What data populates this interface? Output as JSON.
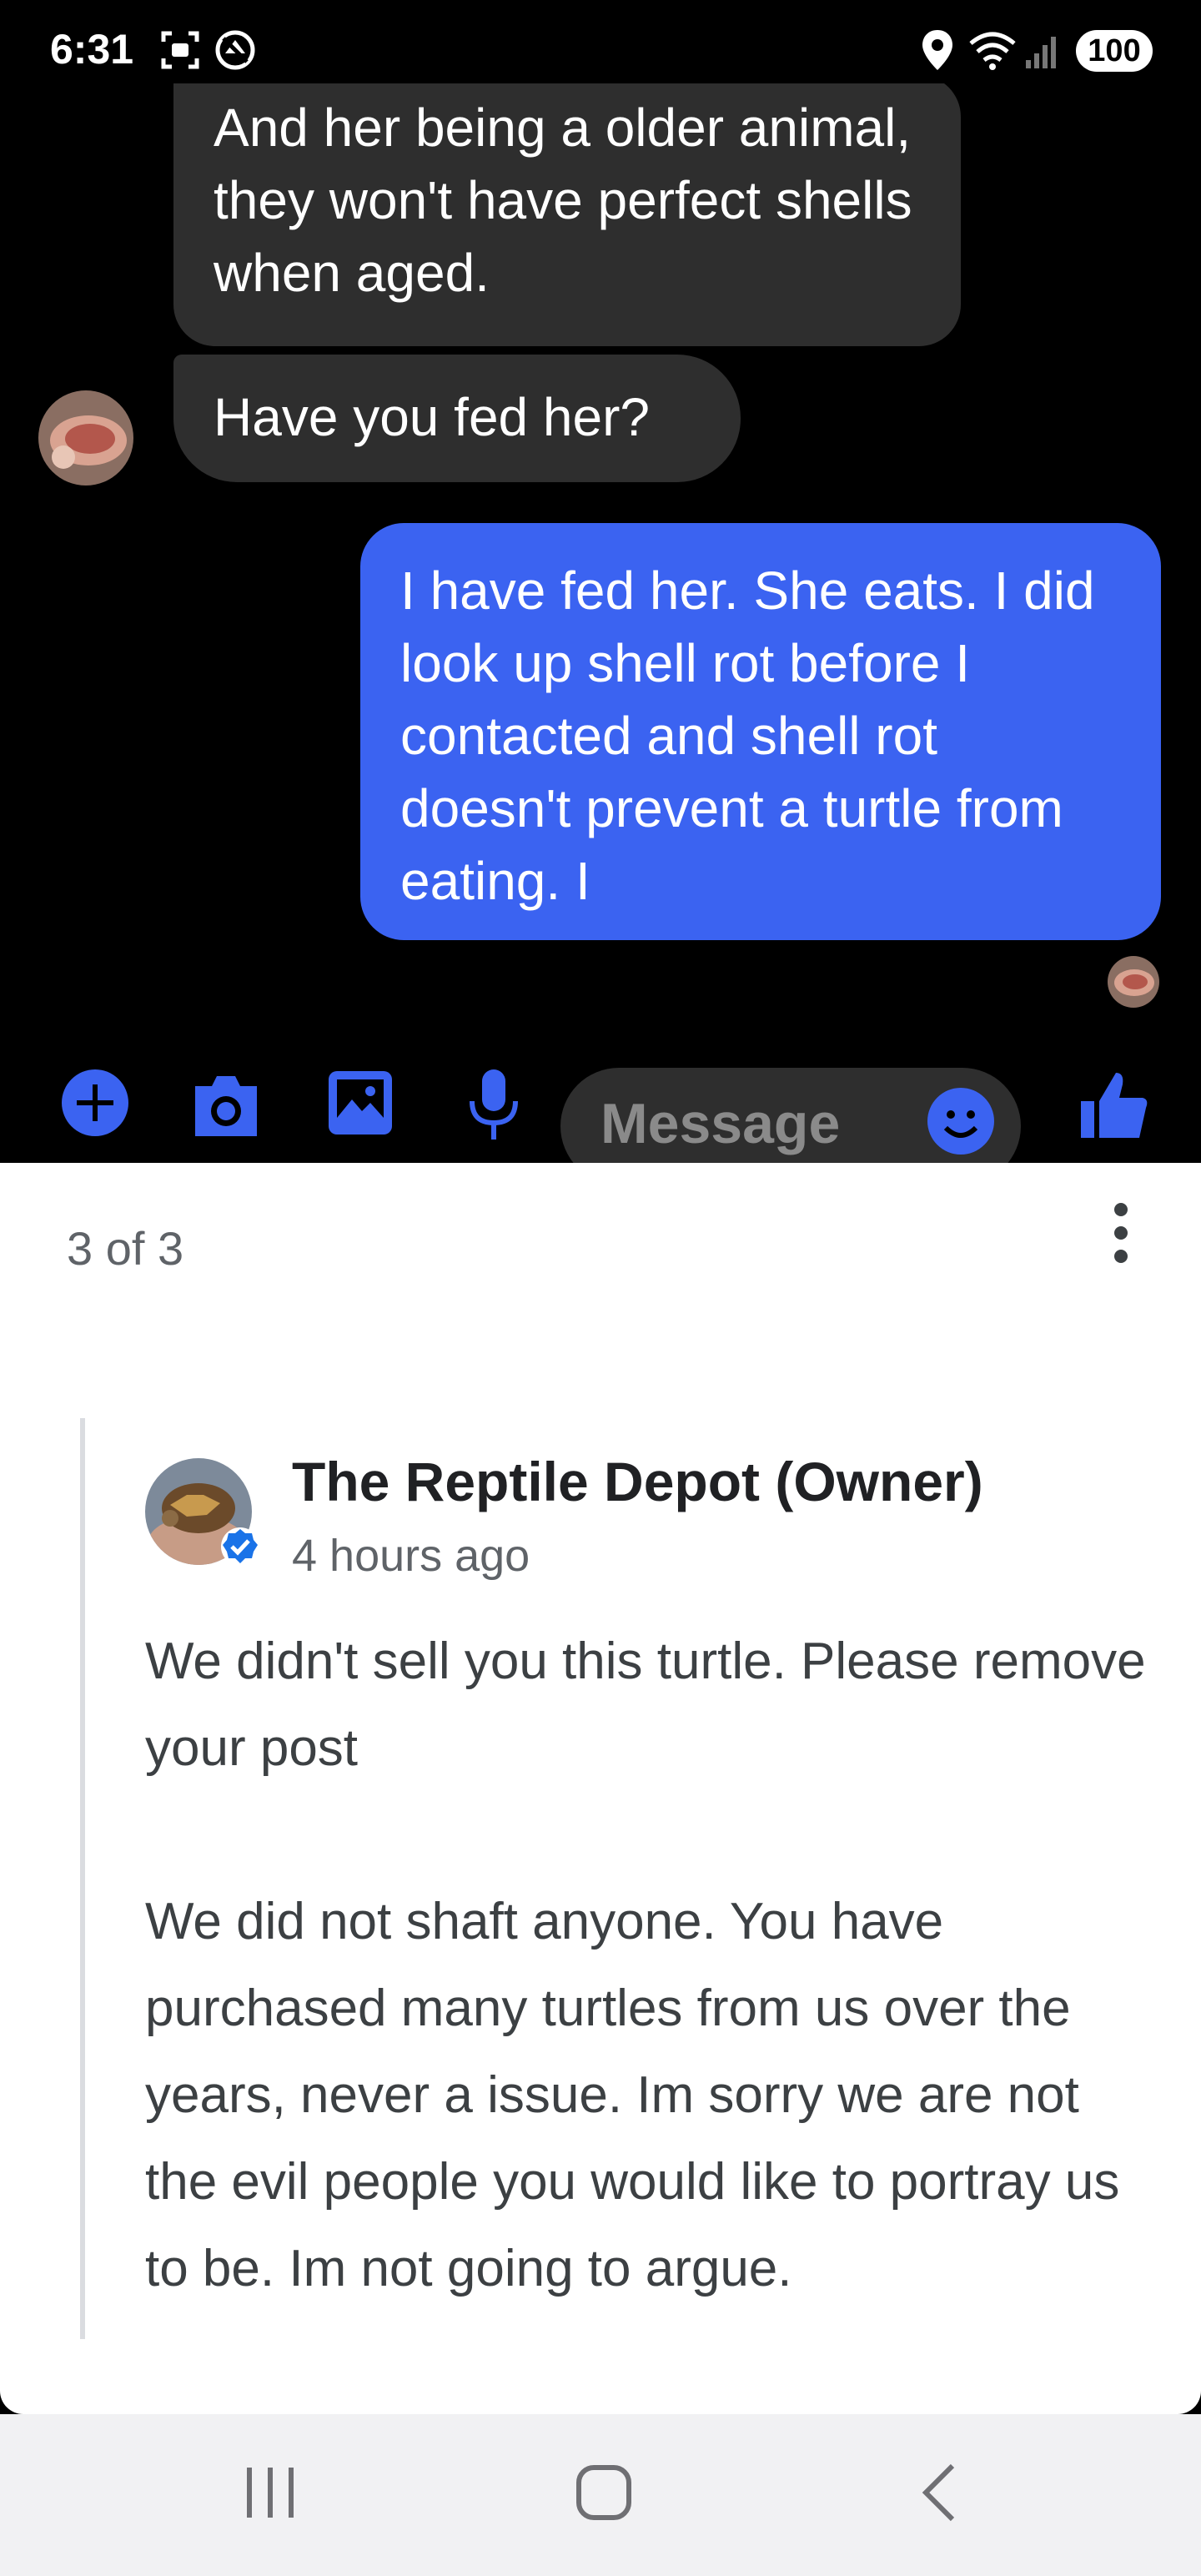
{
  "status_bar": {
    "time": "6:31",
    "battery": "100",
    "icons": [
      "screenshot-icon",
      "no-disturb-icon",
      "location-icon",
      "wifi-icon",
      "signal-icon"
    ]
  },
  "chat": {
    "incoming_messages": [
      "And her being a older animal,  they won't have perfect shells when aged.",
      "Have you fed her?"
    ],
    "outgoing_message": "I have fed her. She eats. I did look up shell rot before I contacted and shell rot doesn't prevent a turtle from eating. I",
    "composer": {
      "placeholder": "Message",
      "icons": [
        "add-icon",
        "camera-icon",
        "gallery-icon",
        "microphone-icon",
        "emoji-icon",
        "thumbs-up-icon"
      ]
    },
    "colors": {
      "incoming_bubble": "#2e2e2e",
      "outgoing_bubble": "#3b63f1",
      "accent": "#3b63f1"
    }
  },
  "sheet": {
    "page_counter": "3 of 3",
    "review": {
      "owner_name": "The Reptile Depot (Owner)",
      "time": "4 hours ago",
      "paragraphs": [
        "We didn't sell you this turtle.  Please remove your post",
        "We did not shaft anyone. You have purchased many turtles from us over the years, never a issue. Im sorry we are not the evil people you would like to portray us to be. Im not going to argue."
      ]
    }
  },
  "nav_bar": {
    "buttons": [
      "recent-apps-icon",
      "home-icon",
      "back-icon"
    ]
  }
}
